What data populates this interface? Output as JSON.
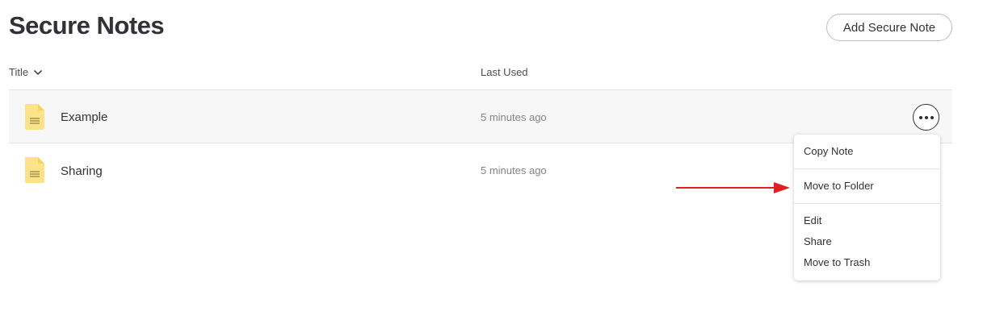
{
  "page": {
    "title": "Secure Notes",
    "add_button_label": "Add Secure Note"
  },
  "columns": {
    "title": "Title",
    "title_sort_icon": "chevron-down-icon",
    "last_used": "Last Used"
  },
  "notes": [
    {
      "title": "Example",
      "last_used": "5 minutes ago",
      "icon": "note-icon"
    },
    {
      "title": "Sharing",
      "last_used": "5 minutes ago",
      "icon": "note-icon"
    }
  ],
  "context_menu": {
    "items": [
      {
        "label": "Copy Note"
      },
      {
        "label": "Move to Folder"
      },
      {
        "label": "Edit"
      },
      {
        "label": "Share"
      },
      {
        "label": "Move to Trash"
      }
    ]
  },
  "colors": {
    "note_icon_fill": "#fce38a",
    "annotation_arrow": "#e02020",
    "row_hover_bg": "#f7f7f7"
  }
}
